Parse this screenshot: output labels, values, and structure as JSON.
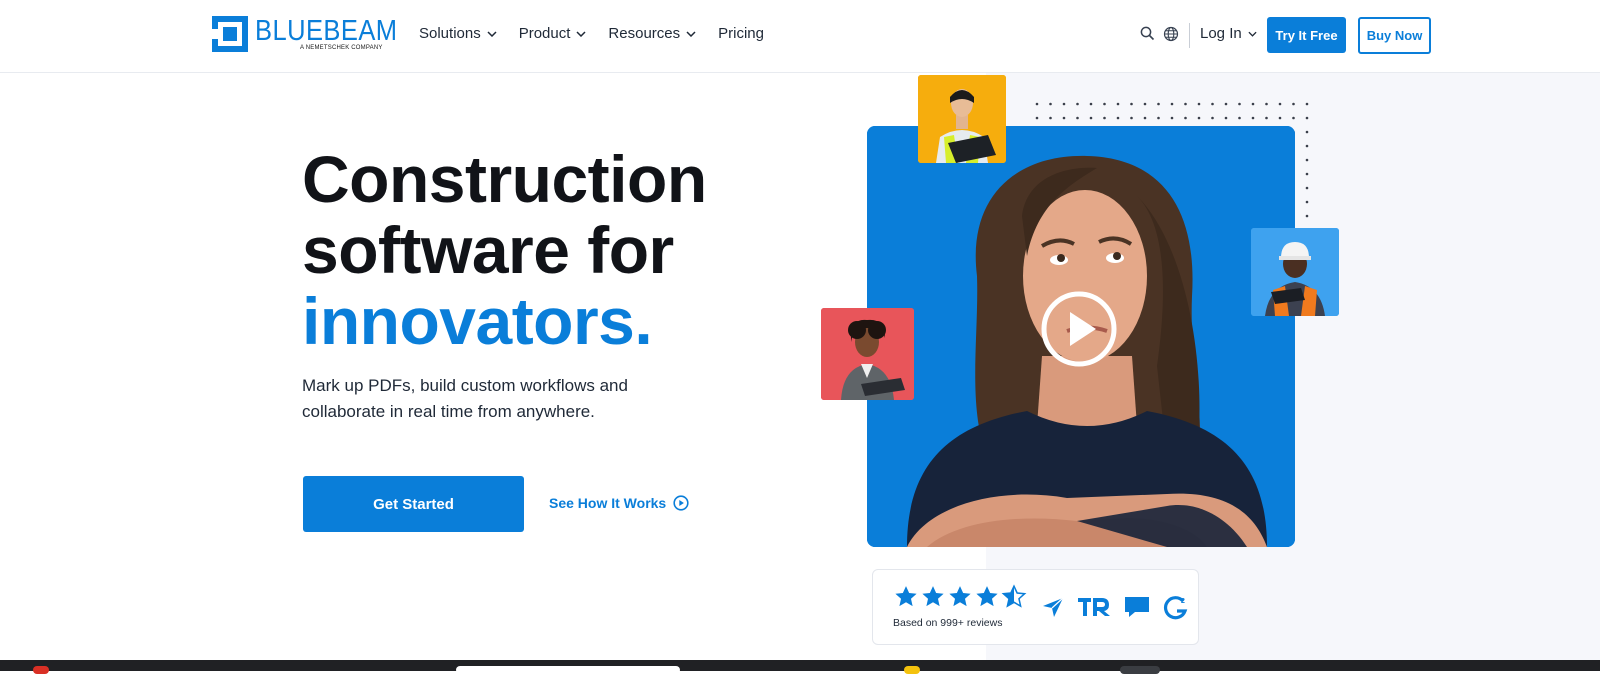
{
  "brand": {
    "name": "BLUEBEAM",
    "tagline": "A NEMETSCHEK COMPANY",
    "color": "#0a7ed9"
  },
  "nav": {
    "items": [
      {
        "label": "Solutions",
        "has_dropdown": true
      },
      {
        "label": "Product",
        "has_dropdown": true
      },
      {
        "label": "Resources",
        "has_dropdown": true
      },
      {
        "label": "Pricing",
        "has_dropdown": false
      }
    ]
  },
  "header_actions": {
    "search_icon": "search-icon",
    "language_icon": "globe-icon",
    "login_label": "Log In",
    "try_label": "Try It Free",
    "buy_label": "Buy Now"
  },
  "hero": {
    "title_line1": "Construction",
    "title_line2": "software for",
    "title_line3": "innovators.",
    "description": "Mark up PDFs, build custom workflows and collaborate in real time from anywhere.",
    "primary_cta": "Get Started",
    "secondary_cta": "See How It Works"
  },
  "reviews": {
    "rating": 4.5,
    "max_rating": 5,
    "caption": "Based on 999+ reviews",
    "platform_icons": [
      "capterra-icon",
      "trustradius-icon",
      "chat-review-icon",
      "g2-icon"
    ]
  },
  "colors": {
    "accent": "#0a7ed9",
    "thumb_yellow": "#f6ad0d",
    "thumb_red": "#e8555a",
    "thumb_blue": "#3ea2ef",
    "shirt_navy": "#17233a"
  }
}
